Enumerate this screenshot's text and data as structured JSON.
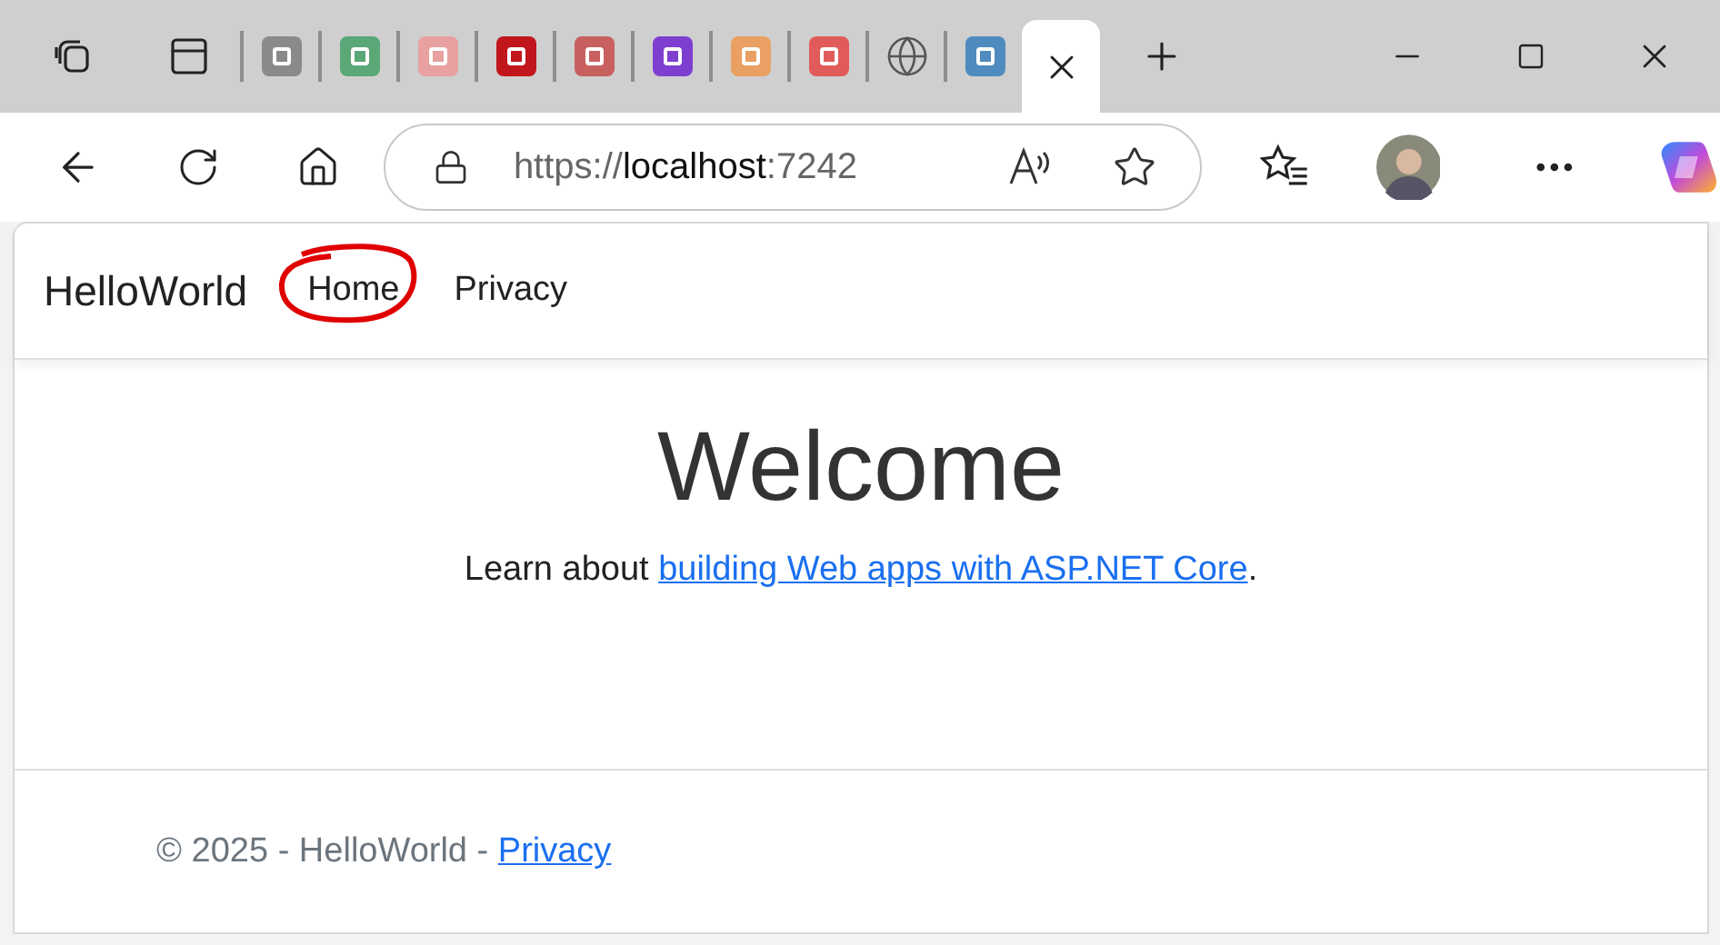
{
  "browser": {
    "tabs": [
      {
        "kind": "favicon",
        "color": "#8a8a8a",
        "selected": false
      },
      {
        "kind": "favicon",
        "color": "#5aa777",
        "selected": false
      },
      {
        "kind": "favicon",
        "color": "#e8a0a0",
        "selected": false
      },
      {
        "kind": "favicon",
        "color": "#c0161c",
        "selected": false
      },
      {
        "kind": "favicon",
        "color": "#c96060",
        "selected": false
      },
      {
        "kind": "favicon",
        "color": "#7e3fd0",
        "selected": false
      },
      {
        "kind": "favicon",
        "color": "#e9a062",
        "selected": false
      },
      {
        "kind": "favicon",
        "color": "#e25b5b",
        "selected": false
      },
      {
        "kind": "globe",
        "color": "#555555",
        "selected": false
      },
      {
        "kind": "favicon",
        "color": "#4f8bbf",
        "selected": false
      },
      {
        "selected": true
      }
    ],
    "address": {
      "scheme": "https://",
      "host": "localhost",
      "port": ":7242"
    }
  },
  "page": {
    "brand": "HelloWorld",
    "nav": [
      {
        "label": "Home",
        "circled": true
      },
      {
        "label": "Privacy",
        "circled": false
      }
    ],
    "heading": "Welcome",
    "lead_text": "Learn about ",
    "lead_link": "building Web apps with ASP.NET Core",
    "lead_end": ".",
    "footer": {
      "text": "© 2025 - HelloWorld - ",
      "link": "Privacy"
    }
  }
}
